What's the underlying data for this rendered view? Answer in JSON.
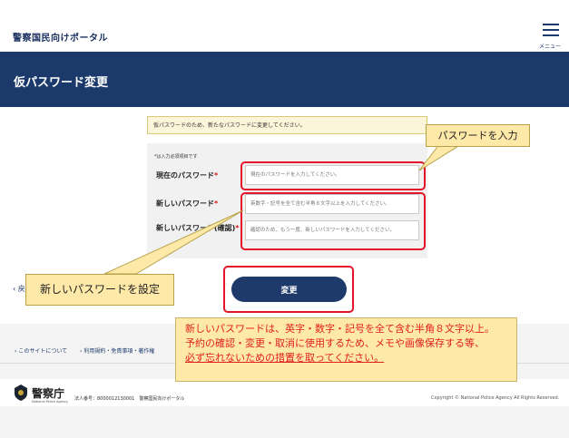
{
  "header": {
    "site_title": "警察国民向けポータル",
    "menu_label": "メニュー"
  },
  "page": {
    "title": "仮パスワード変更"
  },
  "notice": "仮パスワードのため、新たなパスワードに変更してください。",
  "form": {
    "required_note": "*は入力必須項目です",
    "current_password": {
      "label": "現在のパスワード",
      "required_mark": "*",
      "placeholder": "現在のパスワードを入力してください。"
    },
    "new_password": {
      "label": "新しいパスワード",
      "required_mark": "*",
      "placeholder": "英数字・記号を全て含む半角８文字以上を入力してください。"
    },
    "confirm_password": {
      "label": "新しいパスワード(確認)",
      "required_mark": "*",
      "placeholder": "確認のため、もう一度、新しいパスワードを入力してください。"
    },
    "submit_label": "変更",
    "back_label": "戻"
  },
  "callouts": {
    "enter_password": "パスワードを入力",
    "set_new_password": "新しいパスワードを設定"
  },
  "info": {
    "line1": "新しいパスワードは、英字・数字・記号を全て含む半角８文字以上。",
    "line2": "予約の確認・変更・取消に使用するため、メモや画像保存する等、",
    "line3": "必ず忘れないための措置を取ってください。"
  },
  "footer": {
    "links": [
      "このサイトについて",
      "利用規約・免責事項・著作権"
    ],
    "logo_text": "警察庁",
    "logo_sub": "National Police Agency",
    "corp_number": "法人番号：8000012130001　警察国民向けポータル",
    "copyright": "Copyright © National Police Agency All Rights Reserved."
  },
  "colors": {
    "navy": "#1b3a6b",
    "highlight_red": "#e4142a",
    "callout_yellow": "#ffe9a8"
  }
}
